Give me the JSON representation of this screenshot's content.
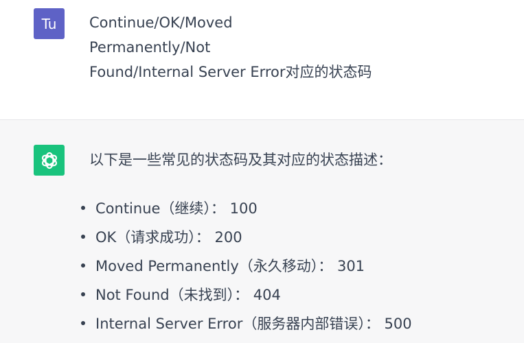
{
  "user_message": {
    "avatar_initials": "Tu",
    "lines": [
      "Continue/OK/Moved",
      "Permanently/Not",
      "Found/Internal Server Error对应的状态码"
    ]
  },
  "assistant_message": {
    "avatar_icon": "chatgpt-logo-icon",
    "intro": "以下是一些常见的状态码及其对应的状态描述：",
    "items": [
      "Continue（继续）： 100",
      "OK（请求成功）： 200",
      "Moved Permanently（永久移动）： 301",
      "Not Found（未找到）： 404",
      "Internal Server Error（服务器内部错误）： 500"
    ]
  },
  "colors": {
    "user_avatar_bg": "#5e62c6",
    "assistant_avatar_bg": "#19c37d",
    "assistant_block_bg": "#f7f7f8",
    "text": "#374151"
  }
}
